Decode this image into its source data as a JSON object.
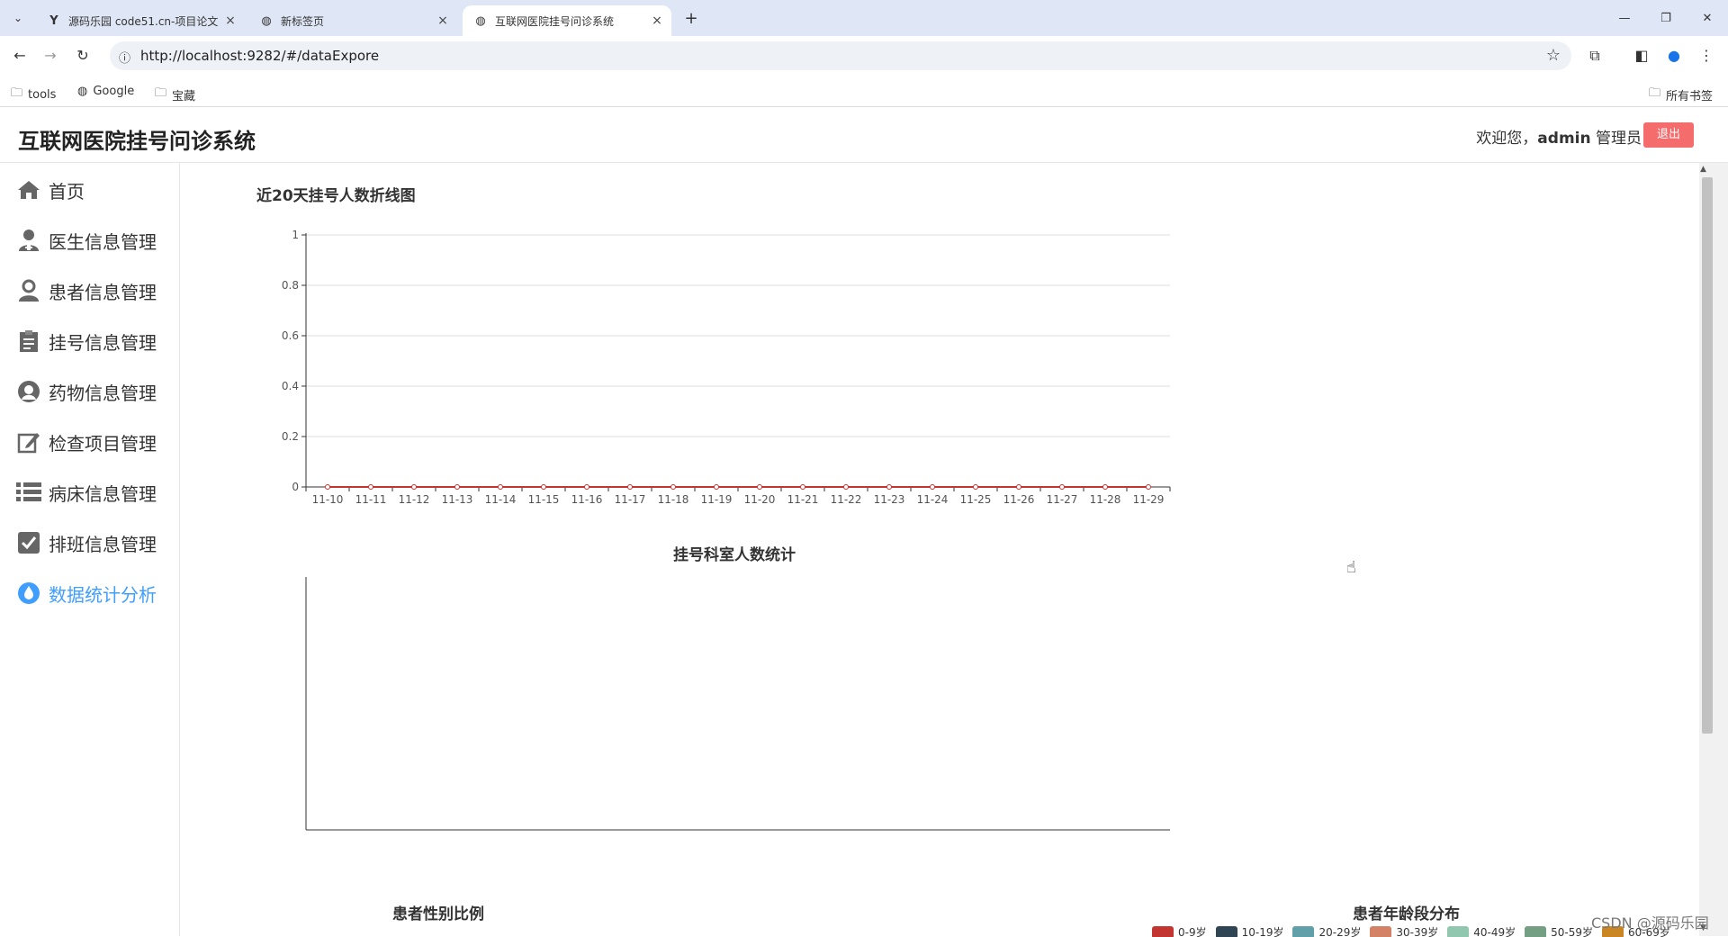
{
  "browser": {
    "tabs": [
      {
        "title": "源码乐园 code51.cn-项目论文",
        "favicon": "y-logo-icon",
        "active": false
      },
      {
        "title": "新标签页",
        "favicon": "globe-icon",
        "active": false
      },
      {
        "title": "互联网医院挂号问诊系统",
        "favicon": "globe-icon",
        "active": true
      }
    ],
    "url": "http://localhost:9282/#/dataExpore",
    "bookmarks": [
      {
        "label": "tools",
        "icon": "folder-icon"
      },
      {
        "label": "Google",
        "icon": "google-icon"
      },
      {
        "label": "宝藏",
        "icon": "folder-icon"
      }
    ],
    "all_bookmarks": "所有书签"
  },
  "header": {
    "title": "互联网医院挂号问诊系统",
    "welcome_prefix": "欢迎您，",
    "username": "admin",
    "role": "管理员",
    "logout_label": "退出"
  },
  "sidebar": {
    "items": [
      {
        "label": "首页",
        "icon": "home-icon",
        "active": false
      },
      {
        "label": "医生信息管理",
        "icon": "doctor-icon",
        "active": false
      },
      {
        "label": "患者信息管理",
        "icon": "patient-icon",
        "active": false
      },
      {
        "label": "挂号信息管理",
        "icon": "clipboard-icon",
        "active": false
      },
      {
        "label": "药物信息管理",
        "icon": "medicine-icon",
        "active": false
      },
      {
        "label": "检查项目管理",
        "icon": "edit-icon",
        "active": false
      },
      {
        "label": "病床信息管理",
        "icon": "list-icon",
        "active": false
      },
      {
        "label": "排班信息管理",
        "icon": "checkbox-icon",
        "active": false
      },
      {
        "label": "数据统计分析",
        "icon": "drop-icon",
        "active": true
      }
    ]
  },
  "colors": {
    "accent": "#409eff",
    "logout": "#f56c6c",
    "line_series": "#c23531",
    "age_legend": [
      "#c23531",
      "#2f4554",
      "#61a0a8",
      "#d48265",
      "#91c7ae",
      "#749f83",
      "#ca8622"
    ]
  },
  "chart_data": [
    {
      "type": "line",
      "title": "近20天挂号人数折线图",
      "categories": [
        "11-10",
        "11-11",
        "11-12",
        "11-13",
        "11-14",
        "11-15",
        "11-16",
        "11-17",
        "11-18",
        "11-19",
        "11-20",
        "11-21",
        "11-22",
        "11-23",
        "11-24",
        "11-25",
        "11-26",
        "11-27",
        "11-28",
        "11-29"
      ],
      "values": [
        0,
        0,
        0,
        0,
        0,
        0,
        0,
        0,
        0,
        0,
        0,
        0,
        0,
        0,
        0,
        0,
        0,
        0,
        0,
        0
      ],
      "ylim": [
        0,
        1
      ],
      "yticks": [
        "0",
        "0.2",
        "0.4",
        "0.6",
        "0.8",
        "1"
      ],
      "grid": true
    },
    {
      "type": "bar",
      "title": "挂号科室人数统计",
      "categories": [],
      "values": []
    },
    {
      "type": "pie",
      "title": "患者性别比例"
    },
    {
      "type": "pie",
      "title": "患者年龄段分布",
      "legend": [
        "0-9岁",
        "10-19岁",
        "20-29岁",
        "30-39岁",
        "40-49岁",
        "50-59岁",
        "60-69岁"
      ],
      "legend_position": "top"
    }
  ],
  "watermark": "CSDN @源码乐园"
}
